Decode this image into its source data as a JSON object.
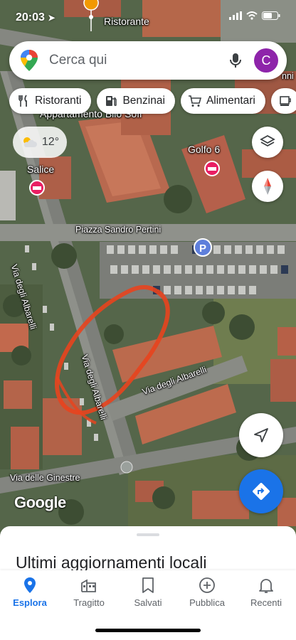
{
  "status": {
    "time": "20:03"
  },
  "search": {
    "placeholder": "Cerca qui",
    "avatar_letter": "C"
  },
  "chips": [
    {
      "label": "Ristoranti",
      "icon": "fork-knife-icon"
    },
    {
      "label": "Benzinai",
      "icon": "fuel-icon"
    },
    {
      "label": "Alimentari",
      "icon": "cart-icon"
    }
  ],
  "weather": {
    "temperature": "12°",
    "icon": "partly-cloudy-icon"
  },
  "map": {
    "labels": {
      "ristorante": "Ristorante",
      "appartamento": "Appartamento Bilo Sofi",
      "salice": "Salice",
      "golfo": "Golfo 6",
      "piazza": "Piazza Sandro Pertini",
      "albarelli_v": "Via degli Albarelli",
      "albarelli_v2": "Via degli Albarelli",
      "albarelli_h": "Via degli Albarelli",
      "ginestre": "Via delle Ginestre",
      "edge": "nni"
    },
    "watermark": "Google",
    "annotation_color": "#e8441e"
  },
  "sheet": {
    "title": "Ultimi aggiornamenti locali"
  },
  "tabs": [
    {
      "label": "Esplora",
      "active": true
    },
    {
      "label": "Tragitto",
      "active": false
    },
    {
      "label": "Salvati",
      "active": false
    },
    {
      "label": "Pubblica",
      "active": false
    },
    {
      "label": "Recenti",
      "active": false
    }
  ],
  "colors": {
    "accent": "#1a73e8",
    "avatar": "#8e24aa",
    "hotel_pin": "#e91e63",
    "restaurant_pin": "#f29900"
  }
}
